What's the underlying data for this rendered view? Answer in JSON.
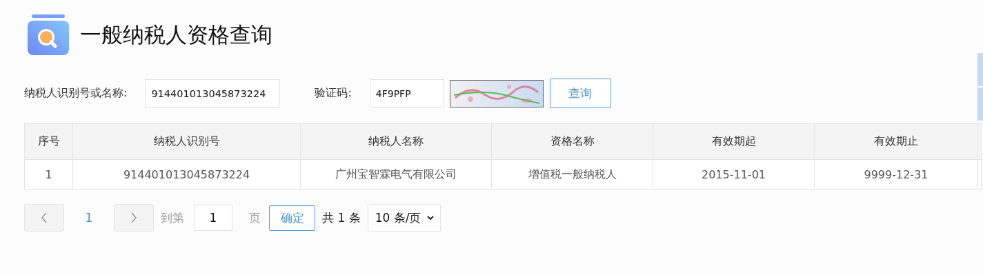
{
  "header": {
    "title": "一般纳税人资格查询"
  },
  "form": {
    "taxpayer_label": "纳税人识别号或名称:",
    "taxpayer_value": "914401013045873224",
    "captcha_label": "验证码:",
    "captcha_value": "4F9PFP",
    "query_button": "查询"
  },
  "table": {
    "columns": [
      "序号",
      "纳税人识别号",
      "纳税人名称",
      "资格名称",
      "有效期起",
      "有效期止"
    ],
    "rows": [
      [
        "1",
        "914401013045873224",
        "广州宝智霖电气有限公司",
        "增值税一般纳税人",
        "2015-11-01",
        "9999-12-31"
      ]
    ]
  },
  "pagination": {
    "prev_disabled": true,
    "next_disabled": true,
    "pages": [
      {
        "label": "1",
        "selected": true
      }
    ],
    "goto_label": "到第",
    "goto_value": "1",
    "page_unit": "页",
    "confirm_button": "确定",
    "total": "共 1 条",
    "page_size": "10 条/页"
  }
}
